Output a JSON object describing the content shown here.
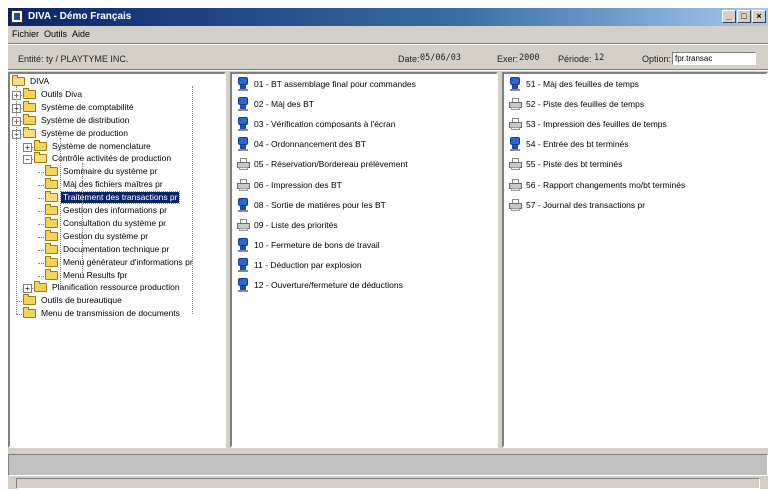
{
  "window": {
    "title": "DIVA - Démo Français",
    "controls": [
      "minimize-icon",
      "maximize-icon",
      "close-icon"
    ]
  },
  "menu": {
    "items": [
      "Fichier",
      "Outils",
      "Aide"
    ]
  },
  "info": {
    "entity": "Entité: ty / PLAYTYME INC.",
    "date_label": "Date:",
    "date_value": "05/06/03",
    "exer_label": "Exer:",
    "exer_value": "2000",
    "period_label": "Période:",
    "period_value": "12",
    "option_label": "Option:",
    "option_value": "fpr.transac"
  },
  "tree": [
    {
      "label": "DIVA",
      "level": 0,
      "expander": "",
      "open": true
    },
    {
      "label": "Outils Diva",
      "level": 1,
      "expander": "+"
    },
    {
      "label": "Système de comptabilité",
      "level": 1,
      "expander": "+"
    },
    {
      "label": "Système de distribution",
      "level": 1,
      "expander": "+"
    },
    {
      "label": "Système de production",
      "level": 1,
      "expander": "-",
      "open": true
    },
    {
      "label": "Système de nomenclature",
      "level": 2,
      "expander": "+"
    },
    {
      "label": "Contrôle activités de production",
      "level": 2,
      "expander": "-",
      "open": true
    },
    {
      "label": "Sommaire du système pr",
      "level": 3,
      "expander": ""
    },
    {
      "label": "Màj des fichiers maîtres pr",
      "level": 3,
      "expander": ""
    },
    {
      "label": "Traitement des transactions pr",
      "level": 3,
      "expander": "",
      "selected": true,
      "open": true
    },
    {
      "label": "Gestion des informations pr",
      "level": 3,
      "expander": ""
    },
    {
      "label": "Consultation du système pr",
      "level": 3,
      "expander": ""
    },
    {
      "label": "Gestion du système pr",
      "level": 3,
      "expander": ""
    },
    {
      "label": "Documentation technique pr",
      "level": 3,
      "expander": ""
    },
    {
      "label": "Menu générateur d'informations pr",
      "level": 3,
      "expander": ""
    },
    {
      "label": "Menu Results fpr",
      "level": 3,
      "expander": ""
    },
    {
      "label": "Planification ressource production",
      "level": 2,
      "expander": "+"
    },
    {
      "label": "Outils de bureautique",
      "level": 1,
      "expander": ""
    },
    {
      "label": "Menu de transmission de documents",
      "level": 1,
      "expander": ""
    }
  ],
  "list_middle": [
    {
      "label": "01 - BT assemblage final pour commandes",
      "icon": "monitor-icon"
    },
    {
      "label": "02 - Màj des BT",
      "icon": "monitor-icon"
    },
    {
      "label": "03 - Vérification composants à l'écran",
      "icon": "monitor-icon"
    },
    {
      "label": "04 - Ordonnancement des BT",
      "icon": "monitor-icon"
    },
    {
      "label": "05 - Réservation/Bordereau prélèvement",
      "icon": "printer-icon"
    },
    {
      "label": "06 - Impression des BT",
      "icon": "printer-icon"
    },
    {
      "label": "08 - Sortie de matières pour les BT",
      "icon": "monitor-icon"
    },
    {
      "label": "09 - Liste des priorités",
      "icon": "printer-icon"
    },
    {
      "label": "10 - Fermeture de bons de travail",
      "icon": "monitor-icon"
    },
    {
      "label": "11 - Déduction par explosion",
      "icon": "monitor-icon"
    },
    {
      "label": "12 - Ouverture/fermeture de déductions",
      "icon": "monitor-icon"
    }
  ],
  "list_right": [
    {
      "label": "51 - Màj des feuilles de temps",
      "icon": "monitor-icon"
    },
    {
      "label": "52 - Piste des feuilles de temps",
      "icon": "printer-icon"
    },
    {
      "label": "53 - Impression des feuilles de temps",
      "icon": "printer-icon"
    },
    {
      "label": "54 - Entrée des bt terminés",
      "icon": "monitor-icon"
    },
    {
      "label": "55 - Piste des bt terminés",
      "icon": "printer-icon"
    },
    {
      "label": "56 - Rapport changements mo/bt terminés",
      "icon": "printer-icon"
    },
    {
      "label": "57 - Journal des transactions pr",
      "icon": "printer-icon"
    }
  ]
}
